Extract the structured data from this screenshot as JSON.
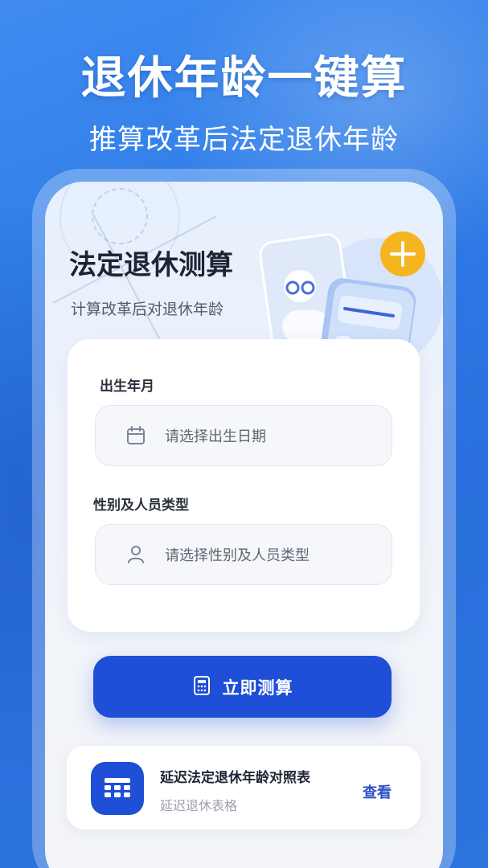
{
  "banner": {
    "headline": "退休年龄一键算",
    "subheadline": "推算改革后法定退休年龄"
  },
  "hero": {
    "title": "法定退休测算",
    "subtitle": "计算改革后对退休年龄"
  },
  "form": {
    "birth_label": "出生年月",
    "birth_placeholder": "请选择出生日期",
    "gender_label": "性别及人员类型",
    "gender_placeholder": "请选择性别及人员类型"
  },
  "primary_button": {
    "label": "立即测算"
  },
  "table_entry": {
    "title": "延迟法定退休年龄对照表",
    "subtitle": "延迟退休表格",
    "action": "查看"
  },
  "colors": {
    "primary": "#1e4fd6",
    "accent_link": "#2b50c8",
    "plus_badge": "#f5b51e",
    "background_blue": "#2f7de8"
  },
  "icons": {
    "calendar": "calendar-icon",
    "user": "user-icon",
    "calculator": "calculator-icon",
    "table": "table-grid-icon",
    "plus": "plus-icon"
  }
}
